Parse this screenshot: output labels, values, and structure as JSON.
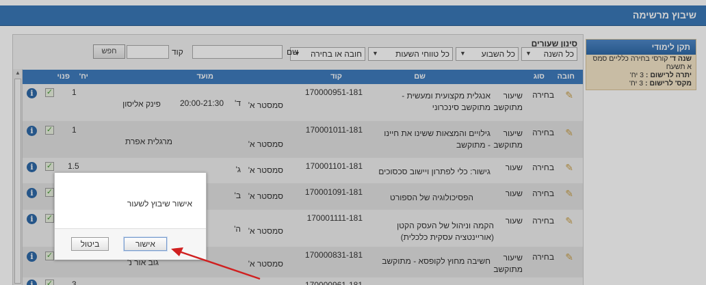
{
  "header": {
    "title": "שיבוץ מרשימה"
  },
  "side_panel": {
    "title": "תקן לימודי",
    "line1_bold": "שנה ד'",
    "line1_text": " קורסי בחירה כלליים סמס",
    "line2": "א תשעח",
    "line3_label": "יתרה לרישום :",
    "line3_value": " 3 יח'",
    "line4_label": "מקס' לרישום :",
    "line4_value": " 3 יח'"
  },
  "filters": {
    "label": "סינון שעורים",
    "year": "כל השנה",
    "week": "כל השבוע",
    "hours": "כל טווחי השעות",
    "type": "חובה או בחירה",
    "name_label": "שם",
    "code_label": "קוד",
    "search_button": "חפש"
  },
  "columns": {
    "mandatory": "חובה",
    "kind": "סוג",
    "name": "שם",
    "code": "קוד",
    "date": "מועד",
    "units": "יח'",
    "free": "פנוי"
  },
  "rows": [
    {
      "mandatory": "בחירה",
      "kind": "שיעור מתוקשב",
      "name": "אנגלית מקצועית ומעשית - מתוקשב סינכרוני",
      "code": "170000951-181",
      "semester": "סמסטר א'",
      "day": "ד'",
      "time": "20:00-21:30",
      "lecturer": "פינק אליסון",
      "units": "1"
    },
    {
      "mandatory": "בחירה",
      "kind": "שיעור מתוקשב",
      "name": "גילויים והמצאות ששינו את חיינו - מתוקשב",
      "code": "170001011-181",
      "semester": "סמסטר א'",
      "day": "",
      "time": "",
      "lecturer": "מרגלית אפרת",
      "units": "1"
    },
    {
      "mandatory": "בחירה",
      "kind": "שעור",
      "name": "גישור: כלי לפתרון ויישוב סכסוכים",
      "code": "170001101-181",
      "semester": "סמסטר א'",
      "day": "ג'",
      "time": "",
      "lecturer": "",
      "units": "1.5"
    },
    {
      "mandatory": "בחירה",
      "kind": "שעור",
      "name": "הפסיכולוגיה של הספורט",
      "code": "170001091-181",
      "semester": "סמסטר א'",
      "day": "ב'",
      "time": "",
      "lecturer": "",
      "units": ""
    },
    {
      "mandatory": "בחירה",
      "kind": "שעור",
      "name": "הקמה וניהול של העסק הקטן (אוריינטציה עסקית כלכלית)",
      "code": "170001111-181",
      "semester": "סמסטר א'",
      "day": "ה'",
      "time": "",
      "lecturer": "",
      "units": ""
    },
    {
      "mandatory": "בחירה",
      "kind": "שיעור מתוקשב",
      "name": "חשיבה מחוץ לקופסא - מתוקשב",
      "code": "170000831-181",
      "semester": "סמסטר א'",
      "day": "",
      "time": "",
      "lecturer": "גוב אור נ'",
      "units": ""
    },
    {
      "mandatory": "",
      "kind": "",
      "name": "",
      "code": "170000961-181",
      "semester": "",
      "day": "",
      "time": "",
      "lecturer": "",
      "units": "3"
    }
  ],
  "dialog": {
    "message": "אישור שיבוץ לשעור",
    "confirm": "אישור",
    "cancel": "ביטול"
  },
  "icons": {
    "info": "info-icon",
    "check": "checkbox-checked-icon",
    "edit": "pencil-icon"
  }
}
